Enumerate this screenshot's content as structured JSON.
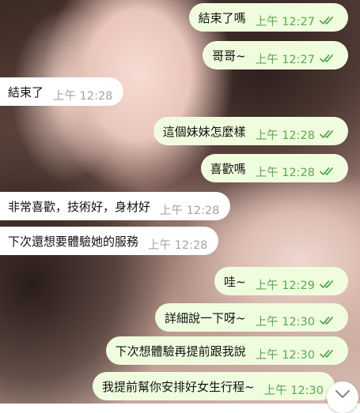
{
  "messages": [
    {
      "dir": "out",
      "text": "結束了嗎",
      "time": "上午 12:27"
    },
    {
      "dir": "out",
      "text": "哥哥~",
      "time": "上午 12:27"
    },
    {
      "dir": "in",
      "text": "結束了",
      "time": "上午 12:28"
    },
    {
      "dir": "out",
      "text": "這個妹妹怎麼樣",
      "time": "上午 12:28"
    },
    {
      "dir": "out",
      "text": "喜歡嗎",
      "time": "上午 12:28"
    },
    {
      "dir": "in",
      "text": "非常喜歡，技術好，身材好",
      "time": "上午 12:28"
    },
    {
      "dir": "in",
      "text": "下次還想要體驗她的服務",
      "time": "上午 12:28"
    },
    {
      "dir": "out",
      "text": "哇~",
      "time": "上午 12:29"
    },
    {
      "dir": "out",
      "text": "詳細說一下呀~",
      "time": "上午 12:30"
    },
    {
      "dir": "out",
      "text": "下次想體驗再提前跟我說",
      "time": "上午 12:30"
    },
    {
      "dir": "out",
      "text": "我提前幫你安排好女生行程~",
      "time": "上午 12:30"
    }
  ],
  "icons": {
    "read_receipt": "double-check-icon",
    "scroll_down": "chevron-down-icon"
  },
  "colors": {
    "outgoing_bubble": "#effdde",
    "incoming_bubble": "#ffffff",
    "outgoing_time": "#5ca853",
    "incoming_time": "#a4a4a4"
  }
}
